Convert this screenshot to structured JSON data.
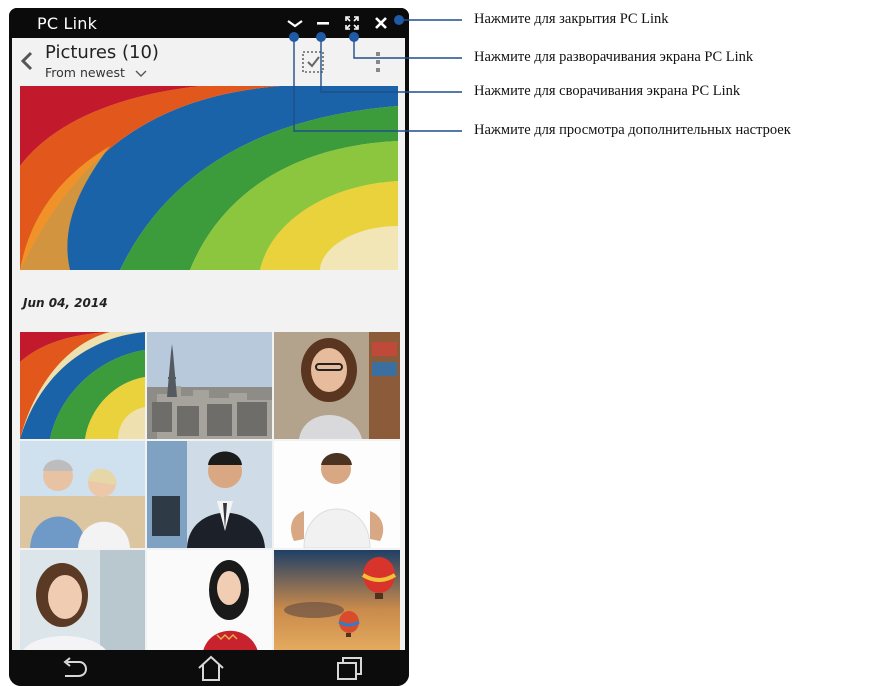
{
  "window": {
    "title": "PC Link",
    "controls": [
      "chevron-down-icon",
      "minimize-icon",
      "maximize-icon",
      "close-icon"
    ]
  },
  "appbar": {
    "title": "Pictures (10)",
    "sort_label": "From newest",
    "icons": [
      "back-arrow-icon",
      "multi-select-icon",
      "overflow-menu-icon"
    ]
  },
  "gallery": {
    "date_header": "Jun 04, 2014",
    "thumbnails": [
      "colorful-paper-fan",
      "paris-eiffel-tower",
      "woman-glasses-library",
      "senior-couple-beach",
      "businessman-office",
      "man-white-tshirt",
      "woman-smiling",
      "woman-red-dress",
      "hot-air-balloons-sunset"
    ]
  },
  "navbar": {
    "icons": [
      "back-icon",
      "home-icon",
      "recent-apps-icon"
    ]
  },
  "annotations": [
    {
      "text": "Нажмите для закрытия PC Link"
    },
    {
      "text": "Нажмите для  разворачивания экрана PC Link"
    },
    {
      "text": "Нажмите для сворачивания экрана PC Link"
    },
    {
      "text": "Нажмите для просмотра дополнительных настроек"
    }
  ],
  "colors": {
    "callout_line": "#1f4e8c",
    "callout_dot": "#1f5aa6",
    "titlebar": "#0b0b0b",
    "screen_bg": "#f2f2f2"
  }
}
